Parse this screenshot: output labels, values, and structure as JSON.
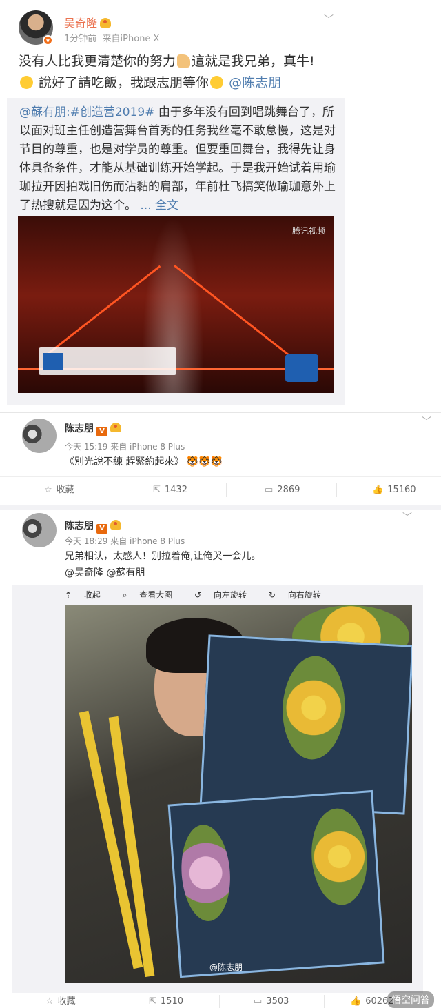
{
  "post1": {
    "author": "吴奇隆",
    "time": "1分钟前",
    "source": "来自iPhone X",
    "text_line1": "没有人比我更清楚你的努力",
    "text_line1b": "這就是我兄弟，真牛!",
    "text_line2": "說好了請吃飯，我跟志朋等你",
    "mention": "@陈志朋",
    "repost": {
      "user": "@蘇有朋",
      "tag": ":#创造营2019#",
      "text": " 由于多年没有回到唱跳舞台了，所以面对班主任创造营舞台首秀的任务我丝毫不敢怠慢，这是对节目的尊重，也是对学员的尊重。但要重回舞台，我得先让身体具备条件，才能从基础训练开始学起。于是我开始试着用瑜珈拉开因拍戏旧伤而沾黏的肩部，年前杜飞搞笑做瑜珈意外上了热搜就是因为这个。",
      "more": " ... 全文",
      "video_logo": "腾讯视频"
    }
  },
  "post2": {
    "author": "陈志朋",
    "v": "V",
    "time": "今天 15:19 来自 iPhone 8 Plus",
    "text": "《別光說不練 趕緊約起來》",
    "actions": {
      "fav": "收藏",
      "repost": "1432",
      "comment": "2869",
      "like": "15160"
    }
  },
  "post3": {
    "author": "陈志朋",
    "v": "V",
    "time": "今天 18:29 来自 iPhone 8 Plus",
    "text": "兄弟相认，太感人！别拉着俺,让俺哭一会儿。",
    "mentions": "@吴奇隆 @蘇有朋",
    "tools": {
      "collapse": "收起",
      "view": "查看大图",
      "rotate_left": "向左旋转",
      "rotate_right": "向右旋转"
    },
    "photo_watermark": "@陈志朋",
    "actions": {
      "fav": "收藏",
      "repost": "1510",
      "comment": "3503",
      "like": "60262"
    },
    "corner_watermark": "悟空问答"
  }
}
